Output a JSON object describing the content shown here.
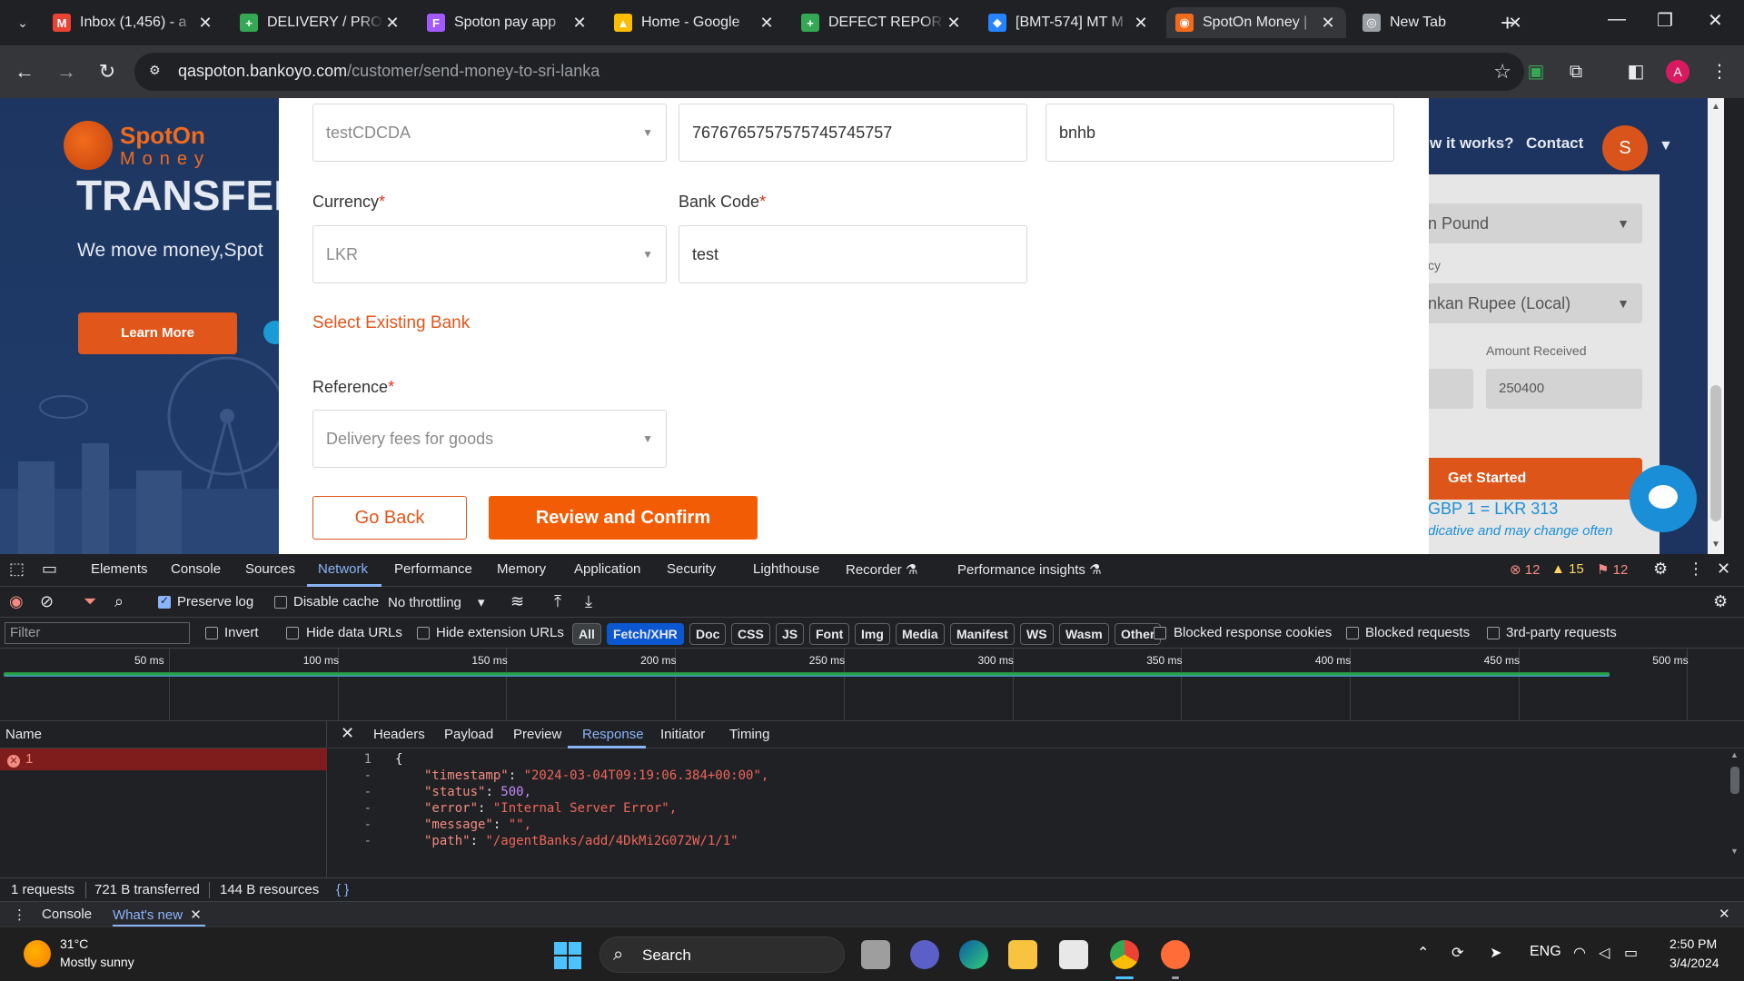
{
  "browser": {
    "tabs": [
      {
        "title": "Inbox (1,456) - a",
        "favicon": "gmail-icon",
        "color": "#ea4335",
        "glyph": "M"
      },
      {
        "title": "DELIVERY / PROJ",
        "favicon": "sheets-icon",
        "color": "#34a853",
        "glyph": "+"
      },
      {
        "title": "Spoton pay app",
        "favicon": "figma-icon",
        "color": "#a259ff",
        "glyph": "F"
      },
      {
        "title": "Home - Google",
        "favicon": "drive-icon",
        "color": "#fbbc04",
        "glyph": "▲"
      },
      {
        "title": "DEFECT REPORT",
        "favicon": "sheets-icon",
        "color": "#34a853",
        "glyph": "+"
      },
      {
        "title": "[BMT-574] MT M",
        "favicon": "jira-icon",
        "color": "#2684ff",
        "glyph": "◆"
      },
      {
        "title": "SpotOn Money |",
        "favicon": "spoton-icon",
        "color": "#f26b1d",
        "glyph": "◉"
      },
      {
        "title": "New Tab",
        "favicon": "chrome-icon",
        "color": "#9aa0a6",
        "glyph": "◎"
      }
    ],
    "active_tab": 6,
    "url_host": "qaspoton.bankoyo.com",
    "url_path": "/customer/send-money-to-sri-lanka",
    "profile_initial": "A"
  },
  "page": {
    "logo_spot": "SpotOn",
    "logo_money": "Money",
    "hero_title": "TRANSFER",
    "hero_sub": "We move money,Spot",
    "learn_more": "Learn More",
    "nav_how": "w it works?",
    "nav_contact": "Contact",
    "user_initial": "S",
    "calc": {
      "from_currency": "n Pound",
      "label_currency": "cy",
      "to_currency": "nkan Rupee (Local)",
      "label_amount_received": "Amount Received",
      "amount_received": "250400",
      "get_started": "Get Started",
      "rate": "GBP 1 = LKR 313",
      "rate_note": "dicative and may change often"
    }
  },
  "form": {
    "bank_select": "testCDCDA",
    "account_number": "767676575757574574575​7",
    "branch": "bnhb",
    "currency_label": "Currency",
    "currency": "LKR",
    "bank_code_label": "Bank Code",
    "bank_code": "test",
    "select_existing_bank": "Select Existing Bank",
    "reference_label": "Reference",
    "reference": "Delivery fees for goods",
    "go_back": "Go Back",
    "review_confirm": "Review and Confirm"
  },
  "devtools": {
    "tabs": [
      "Elements",
      "Console",
      "Sources",
      "Network",
      "Performance",
      "Memory",
      "Application",
      "Security",
      "Lighthouse",
      "Recorder ⚗",
      "Performance insights ⚗"
    ],
    "active_tab": "Network",
    "errors": "12",
    "warnings": "15",
    "issues": "12",
    "preserve_log": "Preserve log",
    "disable_cache": "Disable cache",
    "throttling": "No throttling",
    "filter_placeholder": "Filter",
    "invert": "Invert",
    "hide_data_urls": "Hide data URLs",
    "hide_ext_urls": "Hide extension URLs",
    "types": [
      "All",
      "Fetch/XHR",
      "Doc",
      "CSS",
      "JS",
      "Font",
      "Img",
      "Media",
      "Manifest",
      "WS",
      "Wasm",
      "Other"
    ],
    "blocked_cookies": "Blocked response cookies",
    "blocked_requests": "Blocked requests",
    "third_party": "3rd-party requests",
    "ticks": [
      "50 ms",
      "100 ms",
      "150 ms",
      "200 ms",
      "250 ms",
      "300 ms",
      "350 ms",
      "400 ms",
      "450 ms",
      "500 ms"
    ],
    "name_header": "Name",
    "request_name": "1",
    "detail_tabs": [
      "Headers",
      "Payload",
      "Preview",
      "Response",
      "Initiator",
      "Timing"
    ],
    "active_detail_tab": "Response",
    "response_lines": [
      {
        "ln": "1",
        "key": "",
        "val": "{",
        "vtype": "p"
      },
      {
        "ln": "-",
        "key": "\"timestamp\"",
        "val": "\"2024-03-04T09:19:06.384+00:00\",",
        "vtype": "s"
      },
      {
        "ln": "-",
        "key": "\"status\"",
        "val": "500,",
        "vtype": "n"
      },
      {
        "ln": "-",
        "key": "\"error\"",
        "val": "\"Internal Server Error\",",
        "vtype": "s"
      },
      {
        "ln": "-",
        "key": "\"message\"",
        "val": "\"\",",
        "vtype": "s"
      },
      {
        "ln": "-",
        "key": "\"path\"",
        "val": "\"/agentBanks/add/4DkMi2G072W/1/1\"",
        "vtype": "s"
      }
    ],
    "summary": [
      "1 requests",
      "721 B transferred",
      "144 B resources"
    ],
    "pretty_print": "{ }",
    "drawer_console": "Console",
    "drawer_whats_new": "What's new"
  },
  "taskbar": {
    "temp": "31°C",
    "weather": "Mostly sunny",
    "search": "Search",
    "lang": "ENG",
    "time": "2:50 PM",
    "date": "3/4/2024"
  }
}
